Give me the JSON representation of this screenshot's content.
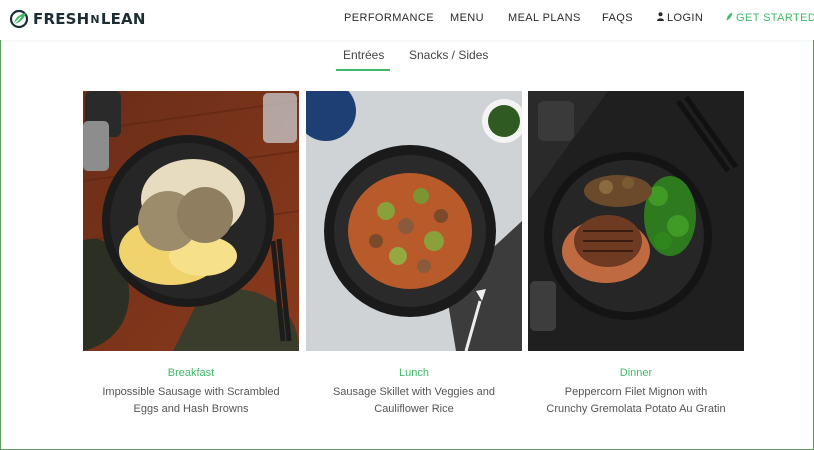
{
  "header": {
    "logo_text_left": "FRESH",
    "logo_text_mid": "N",
    "logo_text_right": "LEAN",
    "logo_icon": "leaf-circle-icon",
    "nav": {
      "performance": "PERFORMANCE",
      "menu": "MENU",
      "meal_plans": "MEAL PLANS",
      "faqs": "FAQS",
      "login": "LOGIN",
      "get_started": "GET STARTED"
    },
    "login_icon": "user-icon",
    "get_started_icon": "leaf-icon"
  },
  "tabs": {
    "items": [
      "Entrées",
      "Snacks / Sides"
    ],
    "active": "Entrées"
  },
  "meals": [
    {
      "label": "Breakfast",
      "description_line1": "Impossible Sausage with Scrambled",
      "description_line2": "Eggs and Hash Browns"
    },
    {
      "label": "Lunch",
      "description_line1": "Sausage Skillet with Veggies and",
      "description_line2": "Cauliflower Rice"
    },
    {
      "label": "Dinner",
      "description_line1": "Peppercorn Filet Mignon with",
      "description_line2": "Crunchy Gremolata Potato Au Gratin"
    }
  ],
  "colors": {
    "accent": "#3fb968",
    "brand_dark": "#1d2d35",
    "text": "#555555"
  }
}
